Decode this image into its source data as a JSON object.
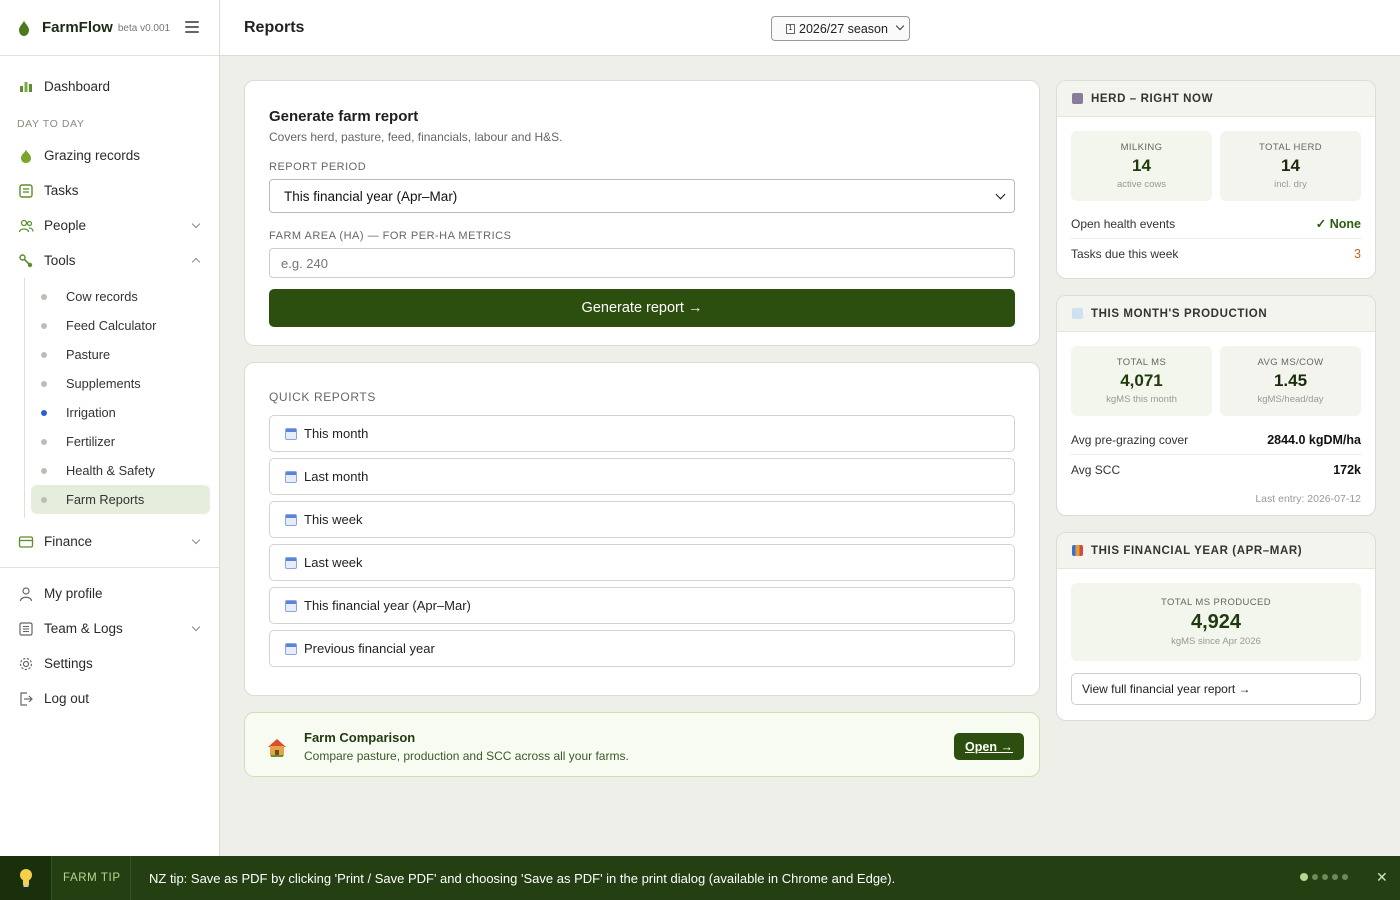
{
  "app": {
    "name": "FarmFlow",
    "version": "beta v0.001"
  },
  "sidebar": {
    "dashboard": "Dashboard",
    "section_day_to_day": "DAY TO DAY",
    "grazing": "Grazing records",
    "tasks": "Tasks",
    "people": "People",
    "tools": "Tools",
    "tools_items": [
      "Cow records",
      "Feed Calculator",
      "Pasture",
      "Supplements",
      "Irrigation",
      "Fertilizer",
      "Health & Safety",
      "Farm Reports"
    ],
    "finance": "Finance",
    "my_profile": "My profile",
    "team_logs": "Team & Logs",
    "settings": "Settings",
    "log_out": "Log out",
    "active_item": "Farm Reports",
    "colors": {
      "active_bg": "#e5eedc",
      "irrigation_dot": "#2b5fd1"
    }
  },
  "header": {
    "title": "Reports",
    "season": "2026/27 season"
  },
  "generate": {
    "title": "Generate farm report",
    "subtitle": "Covers herd, pasture, feed, financials, labour and H&S.",
    "period_label": "REPORT PERIOD",
    "period_value": "This financial year (Apr–Mar)",
    "area_label": "FARM AREA (HA) — FOR PER-HA METRICS",
    "area_placeholder": "e.g. 240",
    "button": "Generate report →"
  },
  "quick_reports": {
    "heading": "QUICK REPORTS",
    "items": [
      "This month",
      "Last month",
      "This week",
      "Last week",
      "This financial year (Apr–Mar)",
      "Previous financial year"
    ]
  },
  "comparison": {
    "title": "Farm Comparison",
    "desc": "Compare pasture, production and SCC across all your farms.",
    "button": "Open →"
  },
  "herd": {
    "title": "HERD – RIGHT NOW",
    "milking_label": "MILKING",
    "milking_value": "14",
    "milking_unit": "active cows",
    "total_label": "TOTAL HERD",
    "total_value": "14",
    "total_unit": "incl. dry",
    "health_label": "Open health events",
    "health_value": "✓ None",
    "tasks_label": "Tasks due this week",
    "tasks_value": "3"
  },
  "production": {
    "title": "THIS MONTH'S PRODUCTION",
    "ms_label": "TOTAL MS",
    "ms_value": "4,071",
    "ms_unit": "kgMS this month",
    "avg_label": "AVG MS/COW",
    "avg_value": "1.45",
    "avg_unit": "kgMS/head/day",
    "cover_label": "Avg pre-grazing cover",
    "cover_value": "2844.0 kgDM/ha",
    "scc_label": "Avg SCC",
    "scc_value": "172k",
    "last_entry": "Last entry: 2026-07-12"
  },
  "financial_year": {
    "title": "THIS FINANCIAL YEAR (APR–MAR)",
    "ms_label": "TOTAL MS PRODUCED",
    "ms_value": "4,924",
    "ms_unit": "kgMS since Apr 2026",
    "button": "View full financial year report →"
  },
  "tip": {
    "label": "FARM TIP",
    "text": "NZ tip: Save as PDF by clicking 'Print / Save PDF' and choosing 'Save as PDF' in the print dialog (available in Chrome and Edge).",
    "close": "✕"
  }
}
